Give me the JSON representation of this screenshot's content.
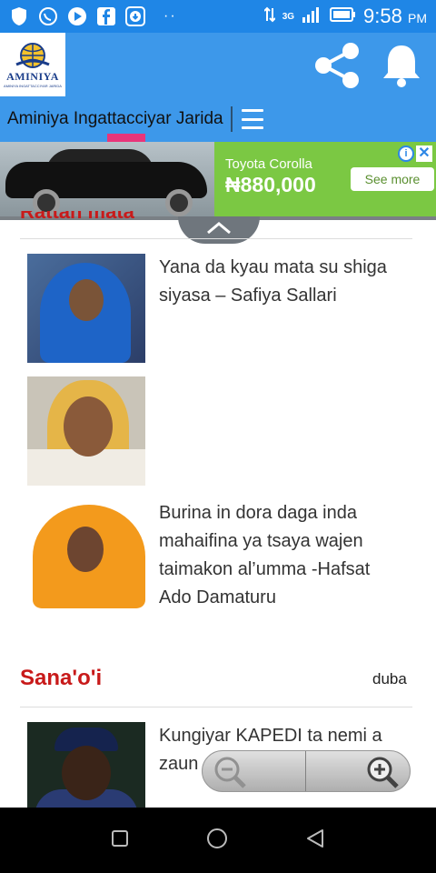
{
  "status_bar": {
    "time": "9:58",
    "ampm": "PM",
    "network": "3G"
  },
  "header": {
    "logo_text": "AMINIYA",
    "logo_subtext": "AMINIYA INGATTACCIYAR JARIDA"
  },
  "title_bar": {
    "site_title": "Aminiya Ingattacciyar Jarida"
  },
  "ad": {
    "title": "Toyota Corolla",
    "price": "₦880,000",
    "cta": "See more"
  },
  "sections": {
    "cut_title": "Rattan mata",
    "articles": [
      {
        "title": "Yana da kyau mata su shiga siyasa – Safiya Sallari"
      },
      {
        "title": ""
      },
      {
        "title": "Burina in dora daga inda mahaifina ya tsaya wajen taimakon al’umma -Hafsat Ado Damaturu"
      }
    ],
    "second": {
      "heading": "Sana'o'i",
      "more": "duba",
      "articles": [
        {
          "title": "Kungiyar KAPEDI ta nemi a zaun"
        }
      ]
    }
  },
  "colors": {
    "header_blue": "#3d98ea",
    "status_blue": "#1f86e6",
    "accent_red": "#c81a1a",
    "tab_indicator": "#e8357a",
    "ad_green": "#7bc843"
  }
}
